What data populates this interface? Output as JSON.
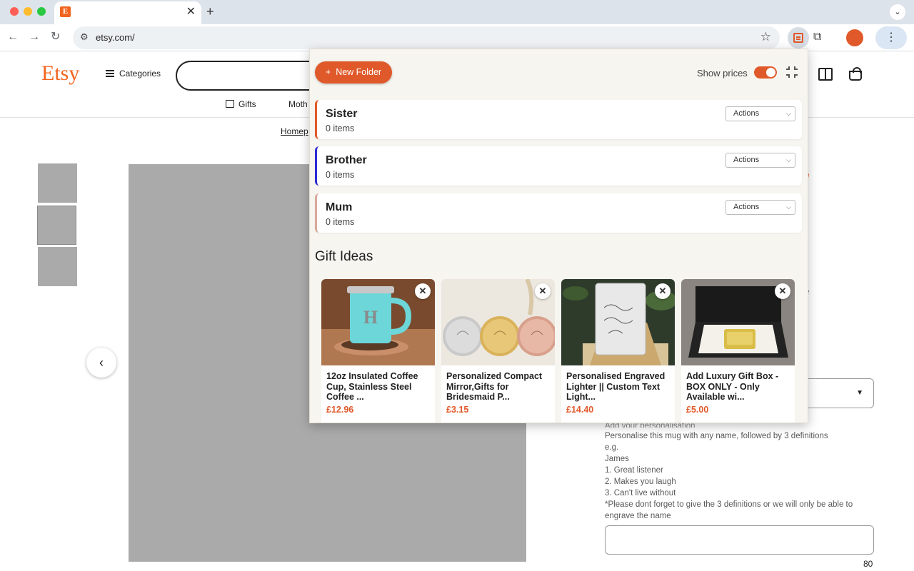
{
  "browser": {
    "tab_favicon": "E",
    "tab_close": "✕",
    "new_tab": "+",
    "tab_menu": "⌄",
    "back": "←",
    "forward": "→",
    "reload": "↻",
    "url": "etsy.com/",
    "menu": "⋮"
  },
  "etsy": {
    "logo": "Etsy",
    "categories": "Categories",
    "nav_gifts": "Gifts",
    "nav_mothers": "Moth",
    "breadcrumb": "Homep",
    "carousel_prev": "‹",
    "personalisation_label": "Add your personalisation",
    "personalisation_lines": [
      "Personalise this mug with any name, followed by 3 definitions",
      "e.g.",
      "James",
      "1. Great listener",
      "2. Makes you laugh",
      "3. Can't live without",
      "*Please dont forget to give the 3 definitions or we will only be able to engrave the name"
    ],
    "char_counter": "80"
  },
  "extension": {
    "new_folder_label": "New Folder",
    "show_prices_label": "Show prices",
    "show_prices_on": true,
    "folders": [
      {
        "name": "Sister",
        "count": "0 items",
        "actions": "Actions",
        "color": "#e0592a"
      },
      {
        "name": "Brother",
        "count": "0 items",
        "actions": "Actions",
        "color": "#2b2bd6"
      },
      {
        "name": "Mum",
        "count": "0 items",
        "actions": "Actions",
        "color": "#d9a89a"
      }
    ],
    "gift_ideas_title": "Gift Ideas",
    "gift_ideas": [
      {
        "title": "12oz Insulated Coffee Cup, Stainless Steel Coffee ...",
        "price": "£12.96"
      },
      {
        "title": "Personalized Compact Mirror,Gifts for Bridesmaid P...",
        "price": "£3.15"
      },
      {
        "title": "Personalised Engraved Lighter || Custom Text Light...",
        "price": "£14.40"
      },
      {
        "title": "Add Luxury Gift Box - BOX ONLY - Only Available wi...",
        "price": "£5.00"
      }
    ],
    "remove_symbol": "✕"
  },
  "colors": {
    "accent": "#e0592a",
    "etsy_orange": "#f1641e",
    "price": "#e0592a"
  }
}
